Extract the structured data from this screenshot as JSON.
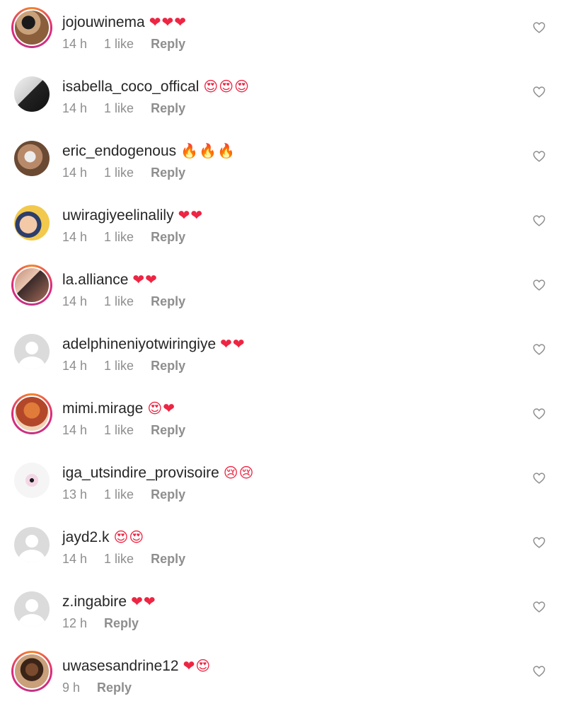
{
  "comments": [
    {
      "username": "jojouwinema",
      "emoji": "❤❤❤",
      "time": "14 h",
      "likes": "1 like",
      "reply": "Reply",
      "avatar": "story-photo"
    },
    {
      "username": "isabella_coco_offical",
      "emoji": "😍😍😍",
      "time": "14 h",
      "likes": "1 like",
      "reply": "Reply",
      "avatar": "photo"
    },
    {
      "username": "eric_endogenous",
      "emoji": "🔥🔥🔥",
      "time": "14 h",
      "likes": "1 like",
      "reply": "Reply",
      "avatar": "photo"
    },
    {
      "username": "uwiragiyeelinalily",
      "emoji": "❤❤",
      "time": "14 h",
      "likes": "1 like",
      "reply": "Reply",
      "avatar": "photo"
    },
    {
      "username": "la.alliance",
      "emoji": "❤❤",
      "time": "14 h",
      "likes": "1 like",
      "reply": "Reply",
      "avatar": "story-photo"
    },
    {
      "username": "adelphineniyotwiringiye",
      "emoji": "❤❤",
      "time": "14 h",
      "likes": "1 like",
      "reply": "Reply",
      "avatar": "default"
    },
    {
      "username": "mimi.mirage",
      "emoji": "😍❤",
      "time": "14 h",
      "likes": "1 like",
      "reply": "Reply",
      "avatar": "story-photo"
    },
    {
      "username": "iga_utsindire_provisoire",
      "emoji": "😢😢",
      "time": "13 h",
      "likes": "1 like",
      "reply": "Reply",
      "avatar": "photo"
    },
    {
      "username": "jayd2.k",
      "emoji": "😍😍",
      "time": "14 h",
      "likes": "1 like",
      "reply": "Reply",
      "avatar": "default"
    },
    {
      "username": "z.ingabire",
      "emoji": "❤❤",
      "time": "12 h",
      "likes": "",
      "reply": "Reply",
      "avatar": "default"
    },
    {
      "username": "uwasesandrine12",
      "emoji": "❤😍",
      "time": "9 h",
      "likes": "",
      "reply": "Reply",
      "avatar": "story-photo"
    }
  ],
  "icons": {
    "like": "heart-outline-icon",
    "default_avatar": "default-user-icon"
  },
  "colors": {
    "text": "#262626",
    "meta": "#8e8e8e",
    "heart_emoji": "#ed2543",
    "story_ring_start": "#f58529",
    "story_ring_end": "#dd2a7b"
  }
}
